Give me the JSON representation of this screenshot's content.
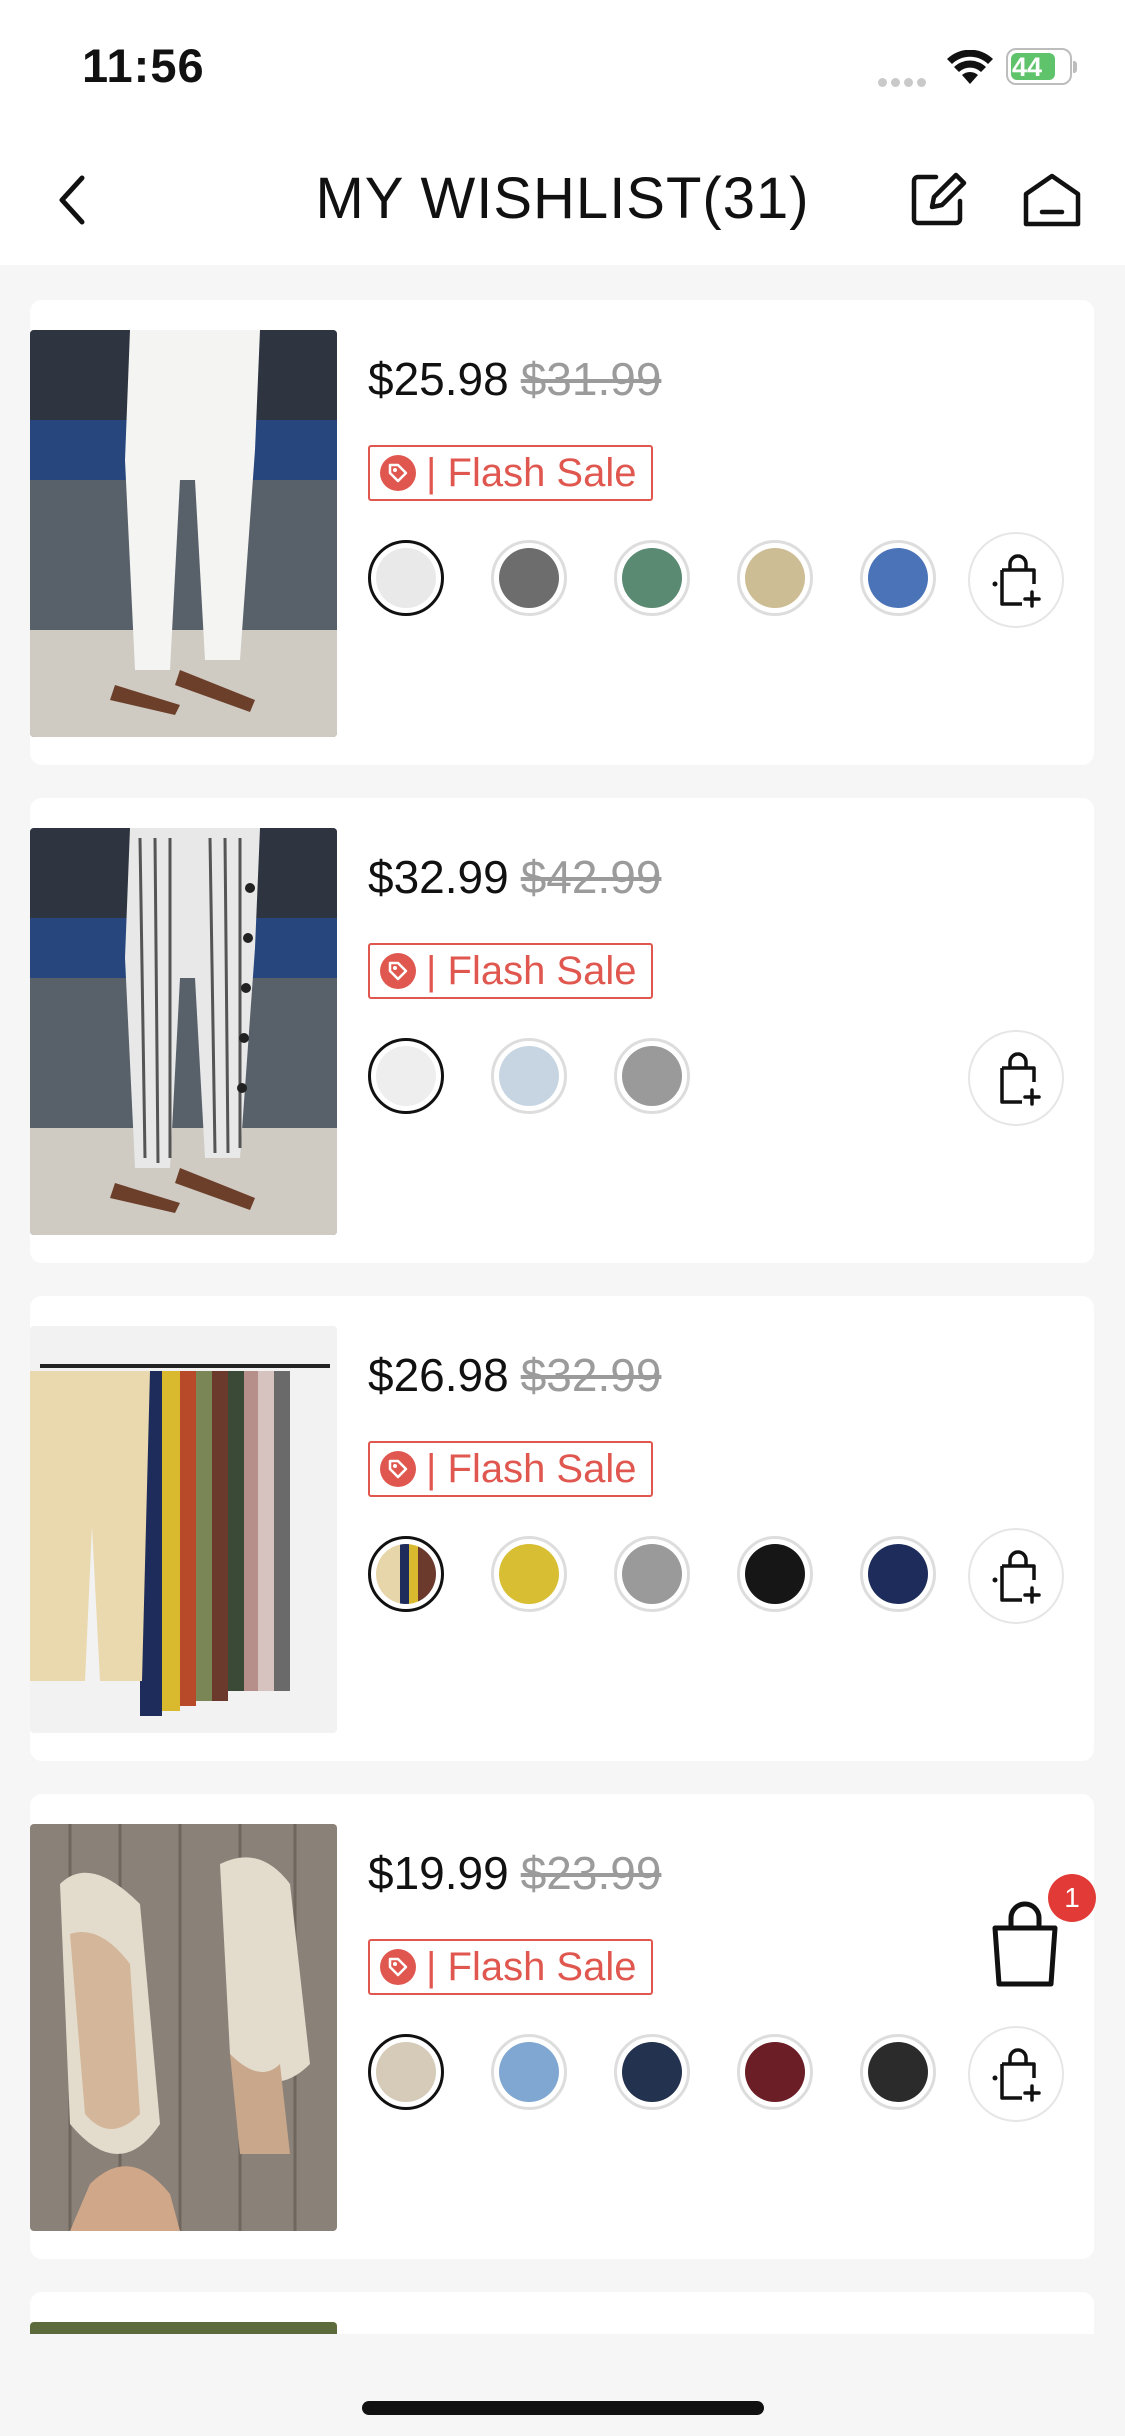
{
  "status": {
    "time": "11:56",
    "battery": "44"
  },
  "nav": {
    "title": "MY WISHLIST(31)"
  },
  "items": [
    {
      "price": "$25.98",
      "original_price": "$31.99",
      "badge": "| Flash Sale",
      "swatch_colors": [
        "#e9e9e9",
        "#6d6d6d",
        "#5a8a72",
        "#cdbd94",
        "#4b74b8"
      ],
      "selected_swatch": 0
    },
    {
      "price": "$32.99",
      "original_price": "$42.99",
      "badge": "| Flash Sale",
      "swatch_colors": [
        "#eeeeee",
        "#c7d5e2",
        "#9a9a9a"
      ],
      "selected_swatch": 0
    },
    {
      "price": "$26.98",
      "original_price": "$32.99",
      "badge": "| Flash Sale",
      "swatch_colors": [
        "#e7d6a9",
        "#d8be32",
        "#9a9a9a",
        "#161616",
        "#1d2c5a"
      ],
      "selected_swatch": 0
    },
    {
      "price": "$19.99",
      "original_price": "$23.99",
      "badge": "| Flash Sale",
      "swatch_colors": [
        "#d5cbb8",
        "#7fa7d1",
        "#23324f",
        "#6b1e25",
        "#2b2b2b"
      ],
      "selected_swatch": 0
    }
  ],
  "cart": {
    "count": "1"
  }
}
